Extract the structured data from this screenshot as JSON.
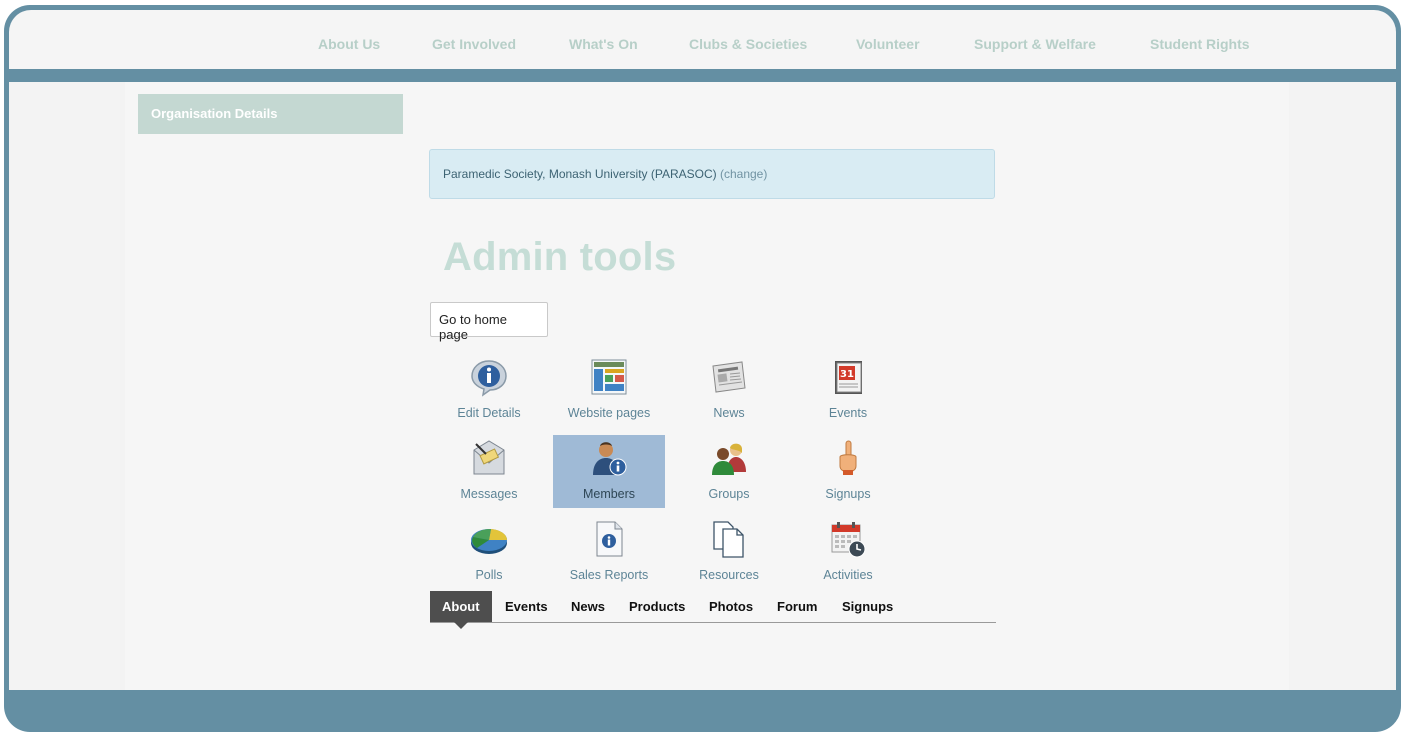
{
  "nav": {
    "items": [
      {
        "label": "About Us"
      },
      {
        "label": "Get Involved"
      },
      {
        "label": "What's On"
      },
      {
        "label": "Clubs & Societies"
      },
      {
        "label": "Volunteer"
      },
      {
        "label": "Support & Welfare"
      },
      {
        "label": "Student Rights"
      }
    ]
  },
  "sidebar": {
    "tab_label": "Organisation Details"
  },
  "organisation": {
    "name": "Paramedic Society, Monash University (PARASOC)",
    "change_label": "(change)"
  },
  "page": {
    "title": "Admin tools",
    "home_button": "Go to home page"
  },
  "tools": [
    {
      "label": "Edit Details",
      "icon": "info-bubble-icon"
    },
    {
      "label": "Website pages",
      "icon": "website-layout-icon"
    },
    {
      "label": "News",
      "icon": "newspaper-icon"
    },
    {
      "label": "Events",
      "icon": "calendar-31-icon"
    },
    {
      "label": "Messages",
      "icon": "envelope-icon"
    },
    {
      "label": "Members",
      "icon": "user-info-icon",
      "selected": true
    },
    {
      "label": "Groups",
      "icon": "users-group-icon"
    },
    {
      "label": "Signups",
      "icon": "raised-finger-icon"
    },
    {
      "label": "Polls",
      "icon": "pie-chart-icon"
    },
    {
      "label": "Sales Reports",
      "icon": "info-document-icon"
    },
    {
      "label": "Resources",
      "icon": "documents-icon"
    },
    {
      "label": "Activities",
      "icon": "calendar-clock-icon"
    }
  ],
  "tabs": [
    {
      "label": "About",
      "active": true
    },
    {
      "label": "Events"
    },
    {
      "label": "News"
    },
    {
      "label": "Products"
    },
    {
      "label": "Photos"
    },
    {
      "label": "Forum"
    },
    {
      "label": "Signups"
    }
  ],
  "colors": {
    "frame": "#648fa3",
    "nav_text": "#b7cfc8",
    "title": "#c5ddd6",
    "selected_tile": "#9fbad6",
    "active_tab": "#4e4e4e"
  }
}
